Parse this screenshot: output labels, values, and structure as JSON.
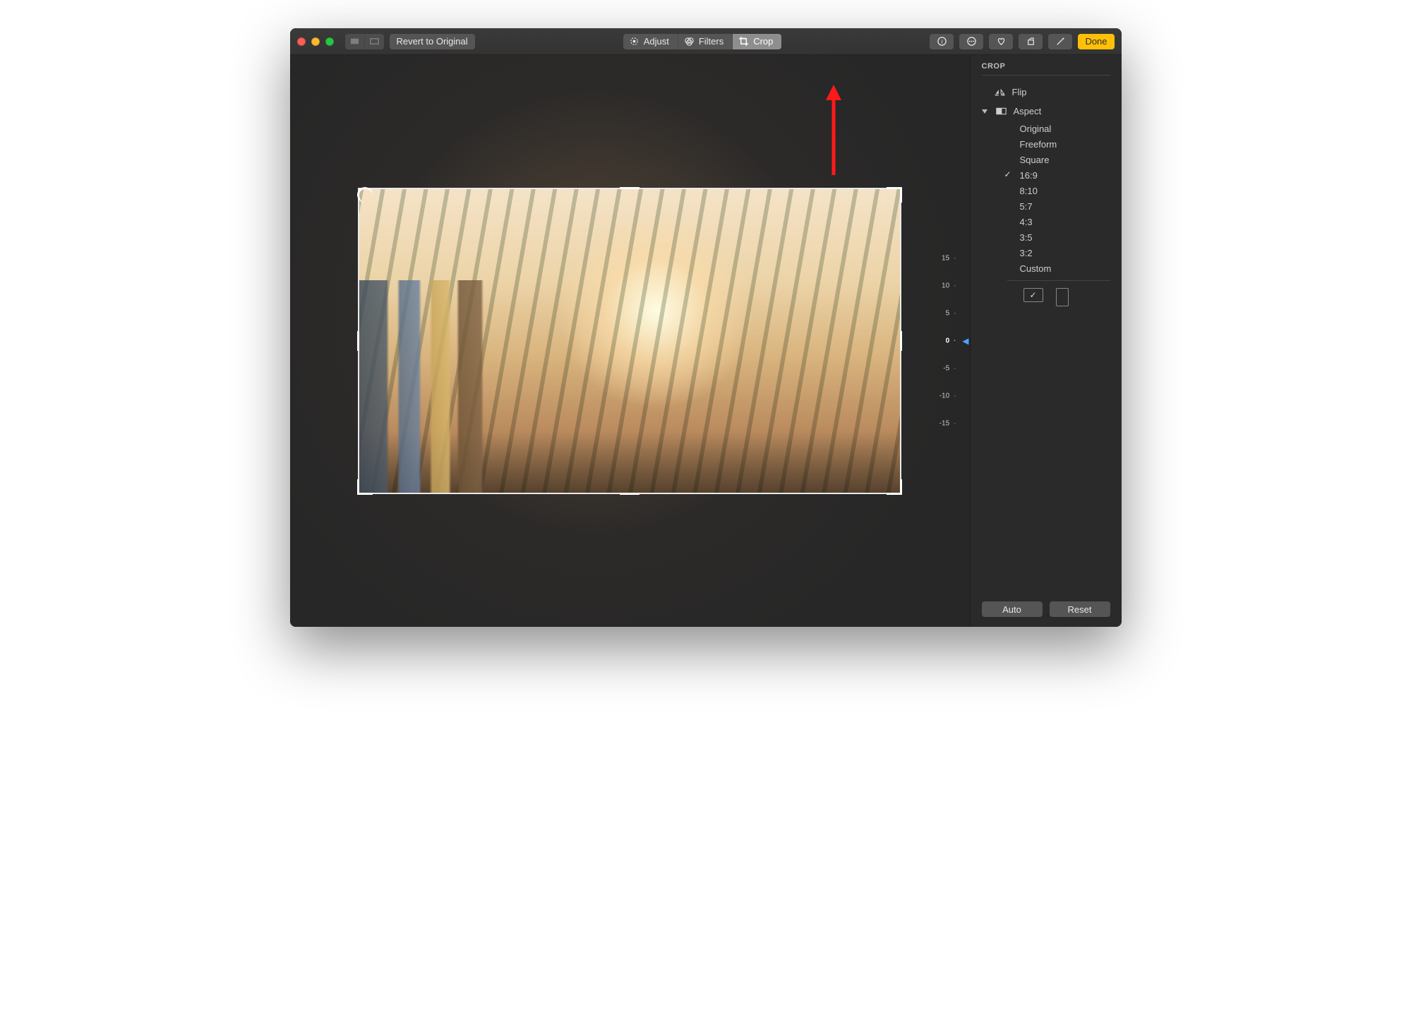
{
  "toolbar": {
    "revert_label": "Revert to Original",
    "done_label": "Done"
  },
  "tabs": {
    "adjust": "Adjust",
    "filters": "Filters",
    "crop": "Crop"
  },
  "rotation": {
    "ticks": [
      "15",
      "10",
      "5",
      "0",
      "-5",
      "-10",
      "-15"
    ],
    "current": "0"
  },
  "sidebar": {
    "title": "CROP",
    "flip_label": "Flip",
    "aspect_label": "Aspect",
    "aspect_options": [
      "Original",
      "Freeform",
      "Square",
      "16:9",
      "8:10",
      "5:7",
      "4:3",
      "3:5",
      "3:2",
      "Custom"
    ],
    "aspect_selected": "16:9",
    "auto_label": "Auto",
    "reset_label": "Reset"
  }
}
